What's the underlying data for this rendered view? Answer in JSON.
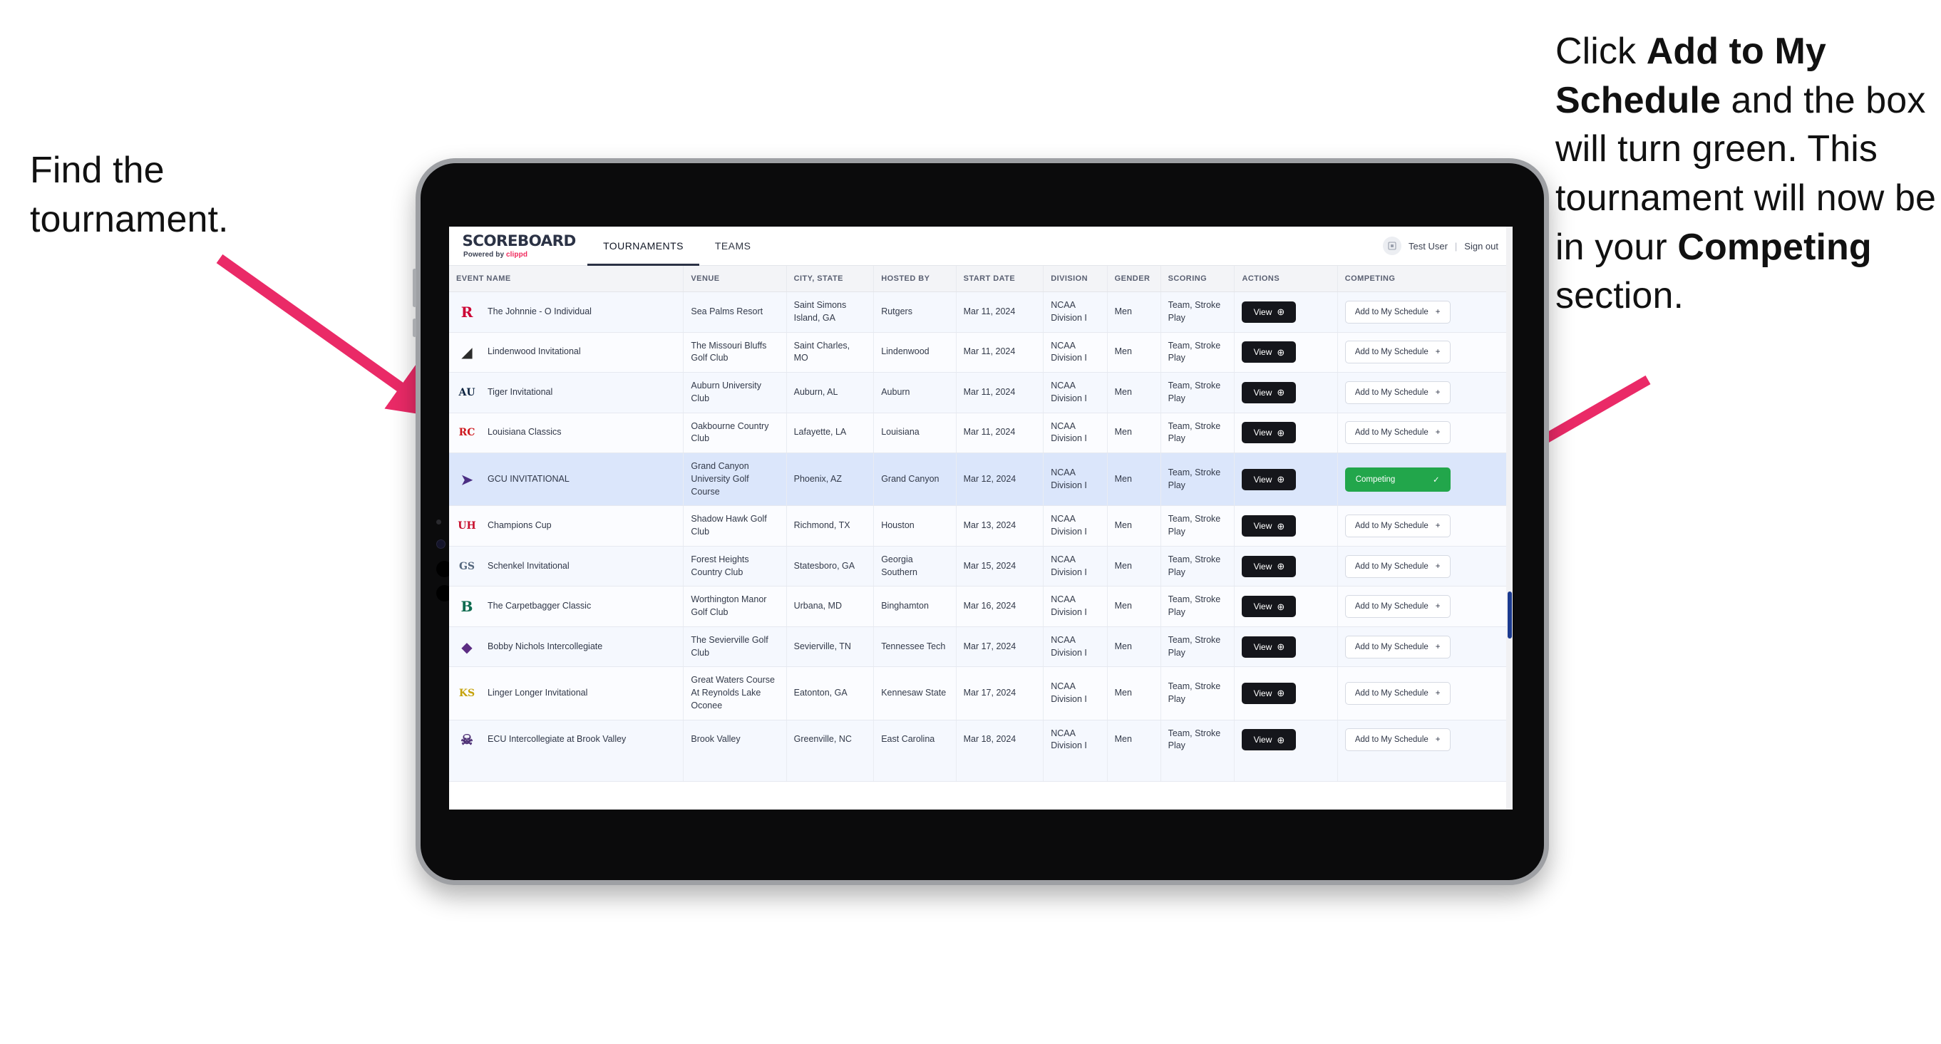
{
  "annotations": {
    "left": "Find the tournament.",
    "right_parts": [
      {
        "text": "Click ",
        "bold": false
      },
      {
        "text": "Add to My Schedule",
        "bold": true
      },
      {
        "text": " and the box will turn green. This tournament will now be in your ",
        "bold": false
      },
      {
        "text": "Competing",
        "bold": true
      },
      {
        "text": " section.",
        "bold": false
      }
    ]
  },
  "app": {
    "brand": {
      "title": "SCOREBOARD",
      "powered_prefix": "Powered by ",
      "powered_name": "clippd"
    },
    "nav": [
      {
        "label": "TOURNAMENTS",
        "active": true
      },
      {
        "label": "TEAMS",
        "active": false
      }
    ],
    "header_right": {
      "avatar_icon": "user-avatar-icon",
      "user_name": "Test User",
      "separator": "|",
      "sign_out": "Sign out"
    },
    "table": {
      "columns": [
        "EVENT NAME",
        "VENUE",
        "CITY, STATE",
        "HOSTED BY",
        "START DATE",
        "DIVISION",
        "GENDER",
        "SCORING",
        "ACTIONS",
        "COMPETING"
      ],
      "action_label": "View",
      "add_label": "Add to My Schedule",
      "add_glyph": "+",
      "competing_label": "Competing",
      "competing_glyph": "✓",
      "competing_color": "#22a64b",
      "rows": [
        {
          "event": "The Johnnie - O Individual",
          "logo": {
            "name": "rutgers-logo",
            "glyph": "R",
            "color": "#cc0033",
            "bg": "transparent"
          },
          "venue": "Sea Palms Resort",
          "city": "Saint Simons Island, GA",
          "hosted_by": "Rutgers",
          "start_date": "Mar 11, 2024",
          "division": "NCAA Division I",
          "gender": "Men",
          "scoring": "Team, Stroke Play",
          "competing": false
        },
        {
          "event": "Lindenwood Invitational",
          "logo": {
            "name": "lindenwood-logo",
            "glyph": "◢",
            "color": "#2b2b2b",
            "bg": "transparent"
          },
          "venue": "The Missouri Bluffs Golf Club",
          "city": "Saint Charles, MO",
          "hosted_by": "Lindenwood",
          "start_date": "Mar 11, 2024",
          "division": "NCAA Division I",
          "gender": "Men",
          "scoring": "Team, Stroke Play",
          "competing": false
        },
        {
          "event": "Tiger Invitational",
          "logo": {
            "name": "auburn-logo",
            "glyph": "AU",
            "color": "#0c2340",
            "bg": "transparent"
          },
          "venue": "Auburn University Club",
          "city": "Auburn, AL",
          "hosted_by": "Auburn",
          "start_date": "Mar 11, 2024",
          "division": "NCAA Division I",
          "gender": "Men",
          "scoring": "Team, Stroke Play",
          "competing": false
        },
        {
          "event": "Louisiana Classics",
          "logo": {
            "name": "louisiana-ragin-cajuns-logo",
            "glyph": "RC",
            "color": "#ce181e",
            "bg": "transparent"
          },
          "venue": "Oakbourne Country Club",
          "city": "Lafayette, LA",
          "hosted_by": "Louisiana",
          "start_date": "Mar 11, 2024",
          "division": "NCAA Division I",
          "gender": "Men",
          "scoring": "Team, Stroke Play",
          "competing": false
        },
        {
          "event": "GCU INVITATIONAL",
          "logo": {
            "name": "grand-canyon-lopes-logo",
            "glyph": "➤",
            "color": "#4b2e83",
            "bg": "transparent"
          },
          "venue": "Grand Canyon University Golf Course",
          "city": "Phoenix, AZ",
          "hosted_by": "Grand Canyon",
          "start_date": "Mar 12, 2024",
          "division": "NCAA Division I",
          "gender": "Men",
          "scoring": "Team, Stroke Play",
          "competing": true
        },
        {
          "event": "Champions Cup",
          "logo": {
            "name": "houston-cougars-logo",
            "glyph": "UH",
            "color": "#c8102e",
            "bg": "transparent"
          },
          "venue": "Shadow Hawk Golf Club",
          "city": "Richmond, TX",
          "hosted_by": "Houston",
          "start_date": "Mar 13, 2024",
          "division": "NCAA Division I",
          "gender": "Men",
          "scoring": "Team, Stroke Play",
          "competing": false
        },
        {
          "event": "Schenkel Invitational",
          "logo": {
            "name": "georgia-southern-eagles-logo",
            "glyph": "GS",
            "color": "#54677d",
            "bg": "transparent"
          },
          "venue": "Forest Heights Country Club",
          "city": "Statesboro, GA",
          "hosted_by": "Georgia Southern",
          "start_date": "Mar 15, 2024",
          "division": "NCAA Division I",
          "gender": "Men",
          "scoring": "Team, Stroke Play",
          "competing": false
        },
        {
          "event": "The Carpetbagger Classic",
          "logo": {
            "name": "binghamton-bearcats-logo",
            "glyph": "B",
            "color": "#0d6b4f",
            "bg": "transparent"
          },
          "venue": "Worthington Manor Golf Club",
          "city": "Urbana, MD",
          "hosted_by": "Binghamton",
          "start_date": "Mar 16, 2024",
          "division": "NCAA Division I",
          "gender": "Men",
          "scoring": "Team, Stroke Play",
          "competing": false
        },
        {
          "event": "Bobby Nichols Intercollegiate",
          "logo": {
            "name": "tennessee-tech-golden-eagles-logo",
            "glyph": "◆",
            "color": "#5c2d83",
            "bg": "transparent"
          },
          "venue": "The Sevierville Golf Club",
          "city": "Sevierville, TN",
          "hosted_by": "Tennessee Tech",
          "start_date": "Mar 17, 2024",
          "division": "NCAA Division I",
          "gender": "Men",
          "scoring": "Team, Stroke Play",
          "competing": false
        },
        {
          "event": "Linger Longer Invitational",
          "logo": {
            "name": "kennesaw-state-owls-logo",
            "glyph": "KS",
            "color": "#c5a20a",
            "bg": "transparent"
          },
          "venue": "Great Waters Course At Reynolds Lake Oconee",
          "city": "Eatonton, GA",
          "hosted_by": "Kennesaw State",
          "start_date": "Mar 17, 2024",
          "division": "NCAA Division I",
          "gender": "Men",
          "scoring": "Team, Stroke Play",
          "competing": false
        },
        {
          "event": "ECU Intercollegiate at Brook Valley",
          "logo": {
            "name": "east-carolina-pirates-logo",
            "glyph": "☠",
            "color": "#4b2d73",
            "bg": "transparent"
          },
          "venue": "Brook Valley",
          "city": "Greenville, NC",
          "hosted_by": "East Carolina",
          "start_date": "Mar 18, 2024",
          "division": "NCAA Division I",
          "gender": "Men",
          "scoring": "Team, Stroke Play",
          "competing": false,
          "clipped": true
        }
      ]
    }
  }
}
